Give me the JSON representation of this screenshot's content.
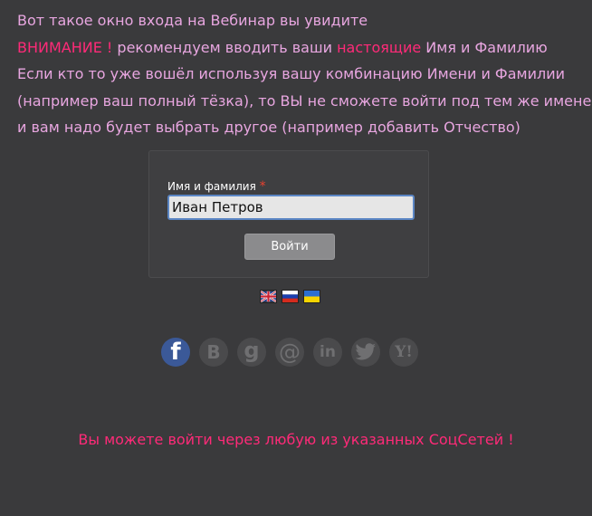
{
  "intro": {
    "line1": "Вот такое окно входа на Вебинар вы увидите",
    "line2_warning": "ВНИМАНИЕ !",
    "line2_part1": " рекомендуем вводить ваши ",
    "line2_highlight": "настоящие",
    "line2_part2": " Имя и Фамилию",
    "line3": "Если кто то уже вошёл используя вашу комбинацию Имени и Фамилии",
    "line4": "(например ваш полный тёзка), то ВЫ не сможете войти под тем же именем",
    "line5": "и вам надо будет выбрать другое (например добавить Отчество)"
  },
  "login": {
    "field_label": "Имя и фамилия",
    "required_mark": "*",
    "name_value": "Иван Петров",
    "button_label": "Войти"
  },
  "languages": [
    "english-flag",
    "russian-flag",
    "ukrainian-flag"
  ],
  "social": {
    "facebook": "f",
    "vk": "B",
    "google": "g",
    "mailru": "@",
    "linkedin": "in",
    "twitter": "twitter-bird-icon",
    "yahoo": "Y!"
  },
  "footer_note": "Вы можете войти через любую из указанных СоцСетей !",
  "colors": {
    "background": "#3a3a3c",
    "intro_text": "#e8a6e0",
    "highlight": "#ff2a78",
    "facebook": "#3b5998"
  }
}
